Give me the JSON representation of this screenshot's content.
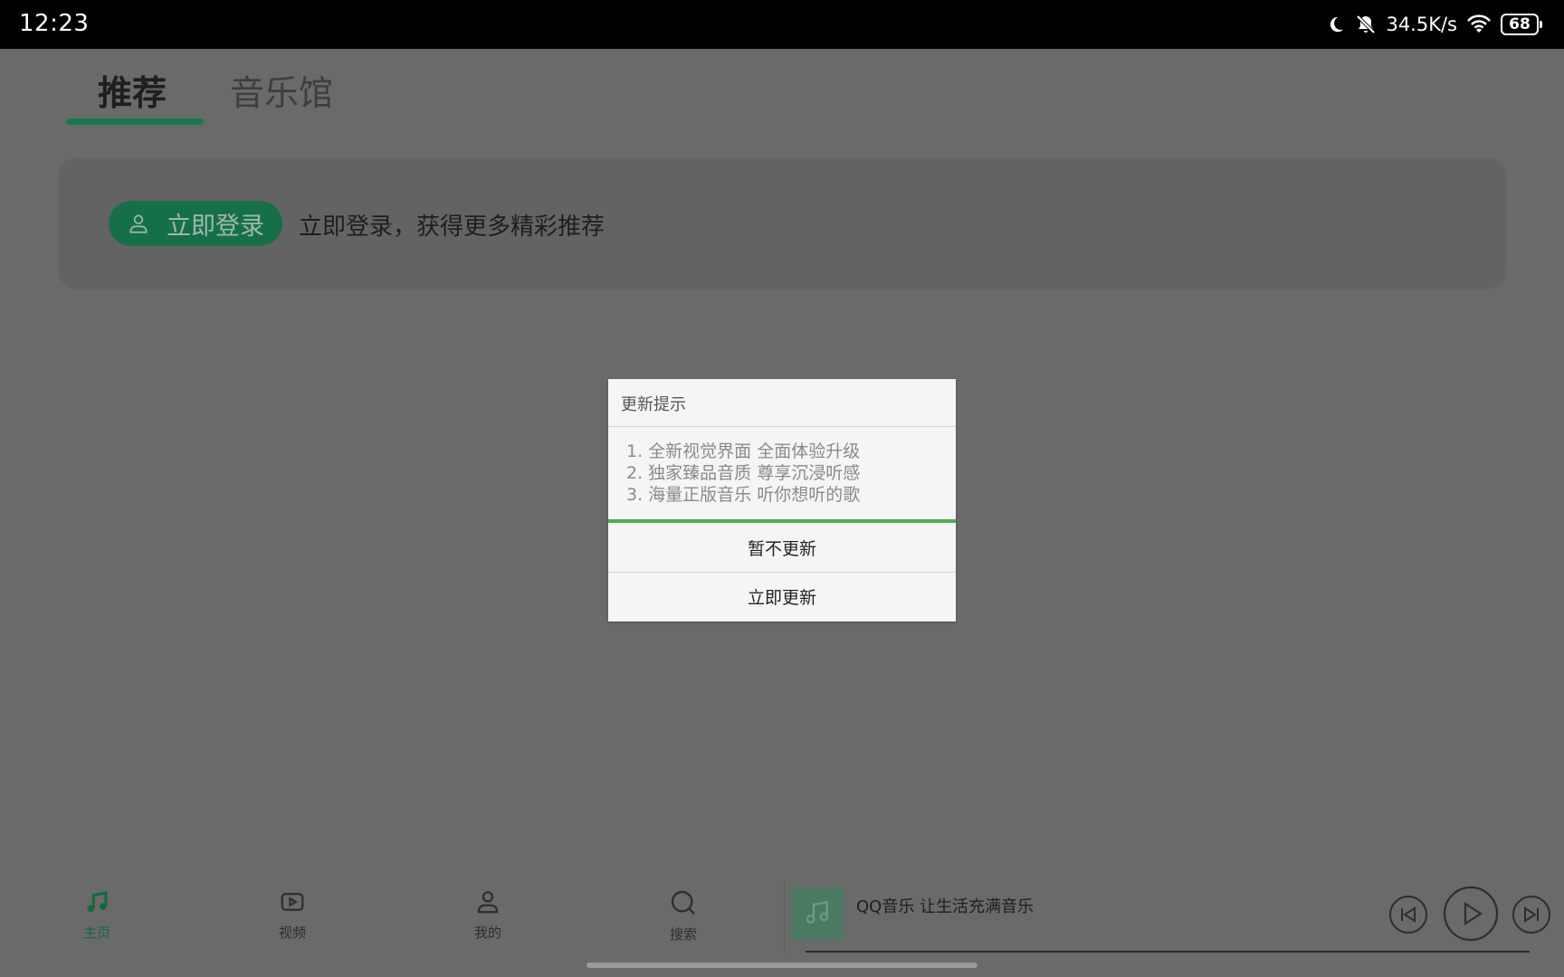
{
  "status_bar": {
    "time": "12:23",
    "network_speed": "34.5K/s",
    "battery_level": "68",
    "icons": [
      "moon-icon",
      "bell-off-icon",
      "wifi-icon",
      "battery-icon"
    ]
  },
  "tabs": [
    {
      "label": "推荐",
      "active": true
    },
    {
      "label": "音乐馆",
      "active": false
    }
  ],
  "login_card": {
    "button_label": "立即登录",
    "prompt": "立即登录，获得更多精彩推荐"
  },
  "dialog": {
    "title": "更新提示",
    "lines": [
      "1. 全新视觉界面 全面体验升级",
      "2. 独家臻品音质 尊享沉浸听感",
      "3. 海量正版音乐 听你想听的歌"
    ],
    "cancel_label": "暂不更新",
    "confirm_label": "立即更新"
  },
  "bottom_nav": [
    {
      "label": "主页",
      "icon": "music-note-icon",
      "active": true
    },
    {
      "label": "视频",
      "icon": "video-icon",
      "active": false
    },
    {
      "label": "我的",
      "icon": "user-icon",
      "active": false
    },
    {
      "label": "搜索",
      "icon": "search-icon",
      "active": false
    }
  ],
  "player": {
    "title": "QQ音乐 让生活充满音乐",
    "controls": [
      "previous-icon",
      "play-icon",
      "next-icon"
    ]
  },
  "colors": {
    "accent": "#15794d",
    "dialog_accent": "#4caf50",
    "overlay": "#6a6a6a"
  }
}
